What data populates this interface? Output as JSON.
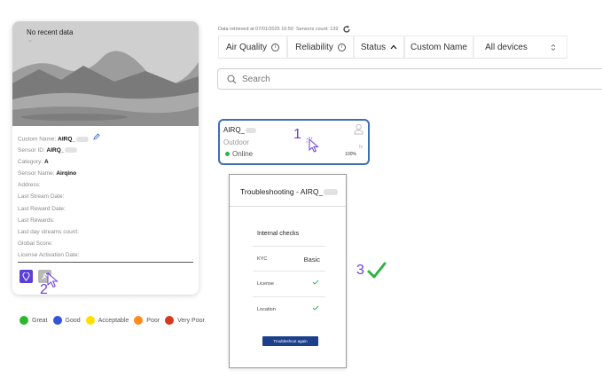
{
  "card": {
    "no_data": "No recent data",
    "fields": [
      {
        "label": "Custom Name:",
        "value": "AIRQ_",
        "redacted": true,
        "editable": true
      },
      {
        "label": "Sensor ID:",
        "value": "AIRQ_",
        "redacted": true
      },
      {
        "label": "Category:",
        "value": "A"
      },
      {
        "label": "Sensor Name:",
        "value": "Airqino"
      },
      {
        "label": "Address:",
        "value": ""
      },
      {
        "label": "Last Stream Date:",
        "value": ""
      },
      {
        "label": "Last Reward Date:",
        "value": ""
      },
      {
        "label": "Last Rewards:",
        "value": ""
      },
      {
        "label": "Last day streams count:",
        "value": ""
      },
      {
        "label": "Global Score:",
        "value": ""
      },
      {
        "label": "License Activation Date:",
        "value": ""
      }
    ],
    "buttons": {
      "map_icon": "map-pin-icon",
      "tool_icon": "wrench-icon"
    }
  },
  "legend": [
    {
      "label": "Great",
      "color": "#2eb82e"
    },
    {
      "label": "Good",
      "color": "#3455db"
    },
    {
      "label": "Acceptable",
      "color": "#ffe000"
    },
    {
      "label": "Poor",
      "color": "#ff8c1a"
    },
    {
      "label": "Very Poor",
      "color": "#d63a1e"
    }
  ],
  "header": {
    "retrieved": "Data retrieved at 07/01/2025 16:50",
    "sensors_count": "Sensors count: 139",
    "tabs": [
      {
        "label": "Air Quality",
        "icon": "info-icon"
      },
      {
        "label": "Reliability",
        "icon": "info-icon"
      },
      {
        "label": "Status",
        "icon": "chevron-up-icon"
      },
      {
        "label": "Custom Name",
        "icon": ""
      }
    ],
    "device_select": "All devices",
    "search_placeholder": "Search"
  },
  "device": {
    "name": "AIRQ_",
    "environment": "Outdoor",
    "status": "Online",
    "percent": "100%",
    "secondary": "fs"
  },
  "panel": {
    "title": "Troubleshooting - AIRQ_",
    "checks_title": "Internal checks",
    "checks": [
      {
        "label": "KYC",
        "value": "Basic",
        "passed": false
      },
      {
        "label": "License",
        "value": "",
        "passed": true
      },
      {
        "label": "Location",
        "value": "",
        "passed": true
      }
    ],
    "button_label": "Troubleshoot again"
  },
  "annotations": {
    "step1": "1",
    "step2": "2",
    "step3": "3"
  },
  "colors": {
    "accent": "#5a3fd8",
    "device_border": "#3d6fb5",
    "online": "#2fb344",
    "check": "#2fb344",
    "button": "#1b3f8b"
  }
}
